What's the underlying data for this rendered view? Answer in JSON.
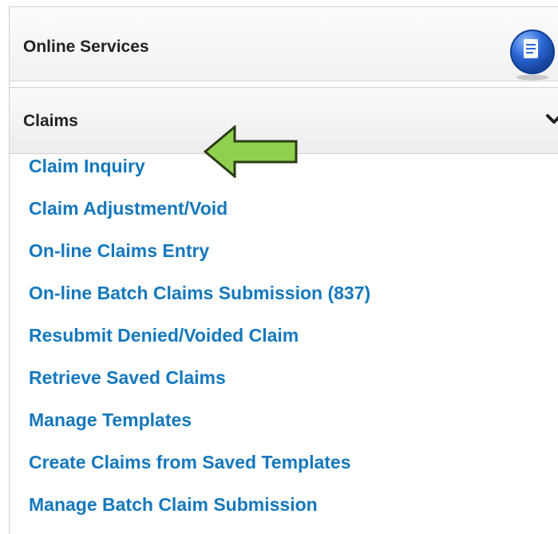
{
  "header": {
    "title": "Online Services",
    "icon": "document-icon"
  },
  "section": {
    "title": "Claims",
    "toggle_icon": "chevron-down-icon"
  },
  "menu": {
    "items": [
      {
        "label": "Claim Inquiry"
      },
      {
        "label": "Claim Adjustment/Void"
      },
      {
        "label": "On-line Claims Entry"
      },
      {
        "label": "On-line Batch Claims Submission (837)"
      },
      {
        "label": "Resubmit Denied/Voided Claim"
      },
      {
        "label": "Retrieve Saved Claims"
      },
      {
        "label": "Manage Templates"
      },
      {
        "label": "Create Claims from Saved Templates"
      },
      {
        "label": "Manage Batch Claim Submission"
      }
    ]
  },
  "colors": {
    "link": "#1478bd",
    "arrow_fill": "#8fd14f",
    "arrow_stroke": "#2b3b14"
  }
}
